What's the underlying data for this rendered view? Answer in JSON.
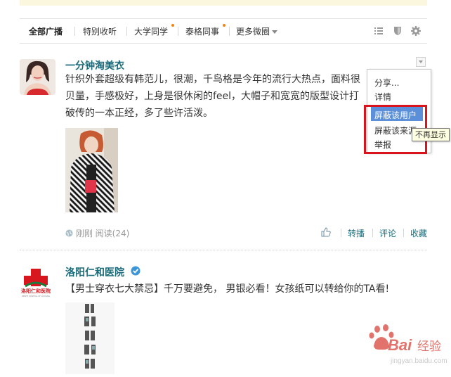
{
  "tabs": [
    {
      "label": "全部广播",
      "active": true
    },
    {
      "label": "特别收听"
    },
    {
      "label": "大学同学",
      "dot": true
    },
    {
      "label": "泰格同事",
      "dot": true
    },
    {
      "label": "更多微圈"
    }
  ],
  "toolbar_icons": [
    "list-view-icon",
    "shield-icon",
    "gear-icon"
  ],
  "posts": [
    {
      "user": "一分钟淘美衣",
      "text": "针织外套超级有韩范儿，很潮，千鸟格是今年的流行大热点，面料很贝量，手感极好，上身是很休闲的feel，大帽子和宽宽的版型设计打破传的一本正经，多了些许活泼。",
      "meta": {
        "time": "刚刚",
        "reads": "阅读(24)"
      },
      "actions": [
        "转播",
        "评论",
        "收藏"
      ]
    },
    {
      "user": "洛阳仁和医院",
      "avatar_text": "洛阳仁和医院",
      "avatar_subtext": "RENHE HOSPITAL OF LUOYANG",
      "text": "【男士穿衣七大禁忌】千万要避免， 男银必看！女孩纸可以转给你的TA看!"
    }
  ],
  "dropdown": {
    "items": [
      "分享...",
      "详情",
      "屏蔽该用户",
      "屏蔽该来源",
      "举报"
    ],
    "highlighted": "屏蔽该用户"
  },
  "tooltip": "不再显示",
  "watermark": {
    "brand": "Bai",
    "brand_cn": "经验",
    "url": "jingyan.baidu.com"
  },
  "colors": {
    "link": "#1a6b7a",
    "highlight": "#5b8fd9",
    "annotation_red": "#d9141c",
    "dot": "#f08418"
  }
}
